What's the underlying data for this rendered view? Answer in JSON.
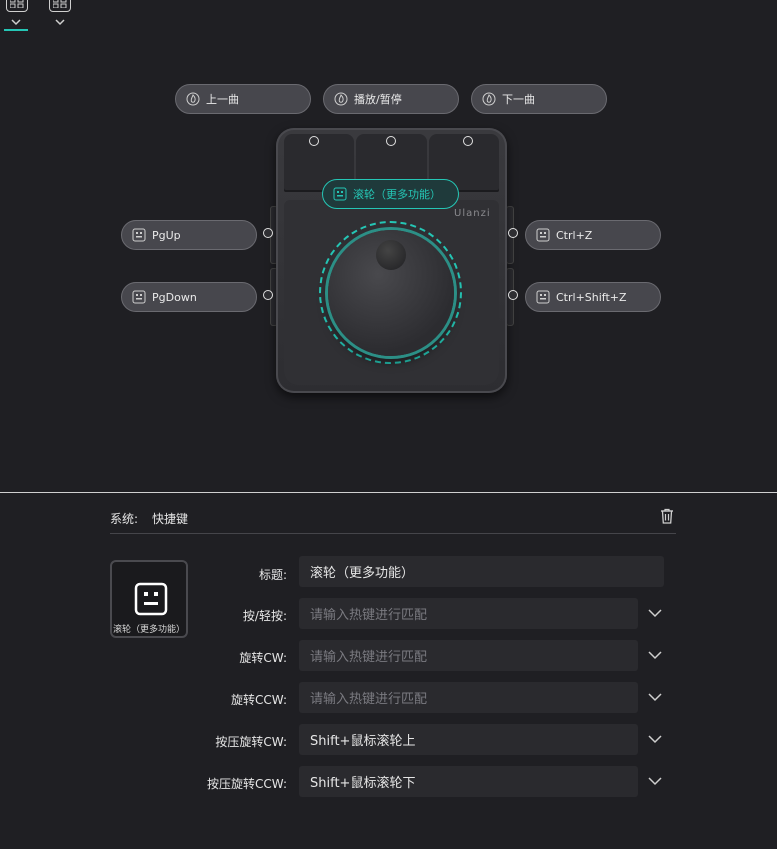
{
  "device": {
    "brand": "Ulanzi",
    "buttons": {
      "top_left": {
        "label": "上一曲",
        "icon": "fire-icon"
      },
      "top_middle": {
        "label": "播放/暂停",
        "icon": "fire-icon"
      },
      "top_right": {
        "label": "下一曲",
        "icon": "fire-icon"
      },
      "knob": {
        "label": "滚轮（更多功能）",
        "icon": "keyboard-icon"
      },
      "left_upper": {
        "label": "PgUp",
        "icon": "keyboard-icon"
      },
      "left_lower": {
        "label": "PgDown",
        "icon": "keyboard-icon"
      },
      "right_upper": {
        "label": "Ctrl+Z",
        "icon": "keyboard-icon"
      },
      "right_lower": {
        "label": "Ctrl+Shift+Z",
        "icon": "keyboard-icon"
      }
    },
    "accent_color": "#25c6b5"
  },
  "panel": {
    "system_label": "系统:",
    "system_value": "快捷键",
    "preview_caption": "滚轮（更多功能）",
    "rows": [
      {
        "label": "标题:",
        "value": "滚轮（更多功能）",
        "placeholder": ""
      },
      {
        "label": "按/轻按:",
        "value": "",
        "placeholder": "请输入热键进行匹配"
      },
      {
        "label": "旋转CW:",
        "value": "",
        "placeholder": "请输入热键进行匹配"
      },
      {
        "label": "旋转CCW:",
        "value": "",
        "placeholder": "请输入热键进行匹配"
      },
      {
        "label": "按压旋转CW:",
        "value": "Shift+鼠标滚轮上",
        "placeholder": ""
      },
      {
        "label": "按压旋转CCW:",
        "value": "Shift+鼠标滚轮下",
        "placeholder": ""
      }
    ]
  }
}
